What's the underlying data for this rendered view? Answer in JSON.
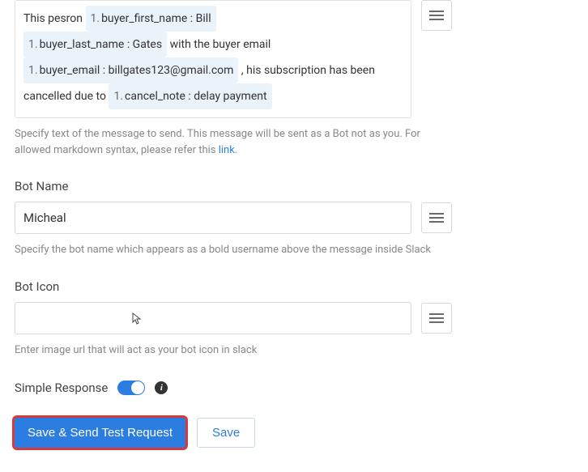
{
  "message": {
    "prefix": "This pesron",
    "token1_num": "1.",
    "token1": "buyer_first_name : Bill",
    "token2_num": "1.",
    "token2": "buyer_last_name : Gates",
    "mid1": " with the buyer email",
    "token3_num": "1.",
    "token3": "buyer_email : billgates123@gmail.com",
    "mid2": " , his subscription has been cancelled due to",
    "token4_num": "1.",
    "token4": "cancel_note : delay payment"
  },
  "help": {
    "message_prefix": "Specify text of the message to send. This message will be sent as a Bot not as you. For allowed markdown syntax, please refer this ",
    "message_link": "link",
    "message_suffix": ".",
    "botname": "Specify the bot name which appears as a bold username above the message inside Slack",
    "boticon": "Enter image url that will act as your bot icon in slack"
  },
  "labels": {
    "botname": "Bot Name",
    "boticon": "Bot Icon",
    "simple_response": "Simple Response"
  },
  "values": {
    "botname": "Micheal",
    "boticon": ""
  },
  "buttons": {
    "primary": "Save & Send Test Request",
    "secondary": "Save"
  }
}
